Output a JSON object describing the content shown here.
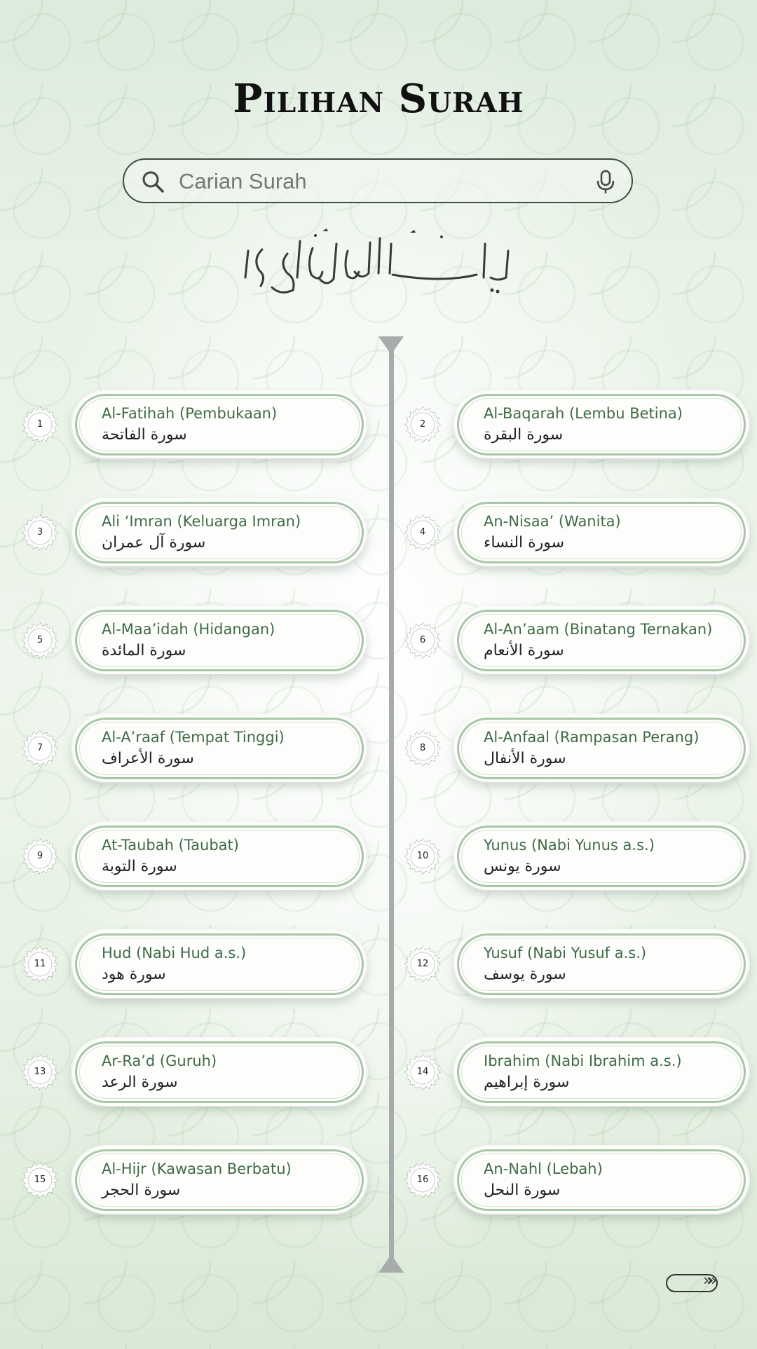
{
  "header": {
    "title": "Pilihan Surah"
  },
  "search": {
    "placeholder": "Carian Surah",
    "value": "",
    "search_icon": "search-icon",
    "voice_icon": "mic-icon"
  },
  "basmala": {
    "text": "بسم الله الرحمن الرحيم"
  },
  "surahs": [
    {
      "number": "1",
      "name": "Al-Fatihah (Pembukaan)",
      "arabic": "سورة الفاتحة"
    },
    {
      "number": "2",
      "name": "Al-Baqarah (Lembu Betina)",
      "arabic": "سورة البقرة"
    },
    {
      "number": "3",
      "name": "Ali ‘Imran (Keluarga Imran)",
      "arabic": "سورة آل عمران"
    },
    {
      "number": "4",
      "name": "An-Nisaa’ (Wanita)",
      "arabic": "سورة النساء"
    },
    {
      "number": "5",
      "name": "Al-Maa’idah (Hidangan)",
      "arabic": "سورة المائدة"
    },
    {
      "number": "6",
      "name": "Al-An’aam (Binatang Ternakan)",
      "arabic": "سورة الأنعام"
    },
    {
      "number": "7",
      "name": "Al-A’raaf (Tempat Tinggi)",
      "arabic": "سورة الأعراف"
    },
    {
      "number": "8",
      "name": "Al-Anfaal (Rampasan Perang)",
      "arabic": "سورة الأنفال"
    },
    {
      "number": "9",
      "name": "At-Taubah (Taubat)",
      "arabic": "سورة التوبة"
    },
    {
      "number": "10",
      "name": "Yunus (Nabi Yunus a.s.)",
      "arabic": "سورة يونس"
    },
    {
      "number": "11",
      "name": "Hud (Nabi Hud a.s.)",
      "arabic": "سورة هود"
    },
    {
      "number": "12",
      "name": "Yusuf (Nabi Yusuf a.s.)",
      "arabic": "سورة يوسف"
    },
    {
      "number": "13",
      "name": "Ar-Ra’d (Guruh)",
      "arabic": "سورة الرعد"
    },
    {
      "number": "14",
      "name": "Ibrahim (Nabi Ibrahim a.s.)",
      "arabic": "سورة إبراهيم"
    },
    {
      "number": "15",
      "name": "Al-Hijr (Kawasan Berbatu)",
      "arabic": "سورة الحجر"
    },
    {
      "number": "16",
      "name": "An-Nahl (Lebah)",
      "arabic": "سورة النحل"
    }
  ],
  "pagination": {
    "next_icon": "double-chevron-right-icon",
    "next_glyph": "»»"
  },
  "colors": {
    "accent": "#3f6b46",
    "card_border": "#a9c6a9",
    "timeline": "#a7acaa",
    "background": "#e8f2e6"
  }
}
